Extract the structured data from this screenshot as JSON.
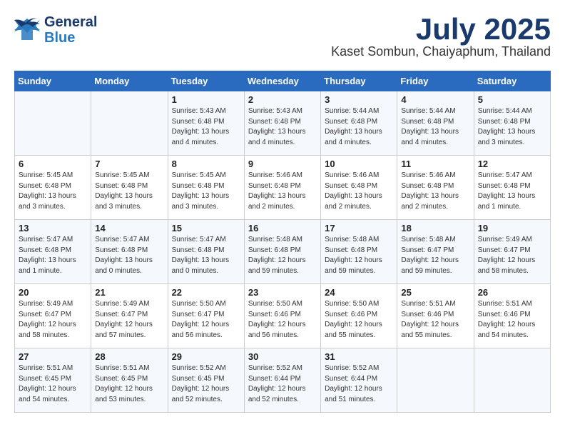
{
  "header": {
    "logo_line1": "General",
    "logo_line2": "Blue",
    "title": "July 2025",
    "subtitle": "Kaset Sombun, Chaiyaphum, Thailand"
  },
  "weekdays": [
    "Sunday",
    "Monday",
    "Tuesday",
    "Wednesday",
    "Thursday",
    "Friday",
    "Saturday"
  ],
  "weeks": [
    [
      {
        "day": "",
        "info": ""
      },
      {
        "day": "",
        "info": ""
      },
      {
        "day": "1",
        "info": "Sunrise: 5:43 AM\nSunset: 6:48 PM\nDaylight: 13 hours\nand 4 minutes."
      },
      {
        "day": "2",
        "info": "Sunrise: 5:43 AM\nSunset: 6:48 PM\nDaylight: 13 hours\nand 4 minutes."
      },
      {
        "day": "3",
        "info": "Sunrise: 5:44 AM\nSunset: 6:48 PM\nDaylight: 13 hours\nand 4 minutes."
      },
      {
        "day": "4",
        "info": "Sunrise: 5:44 AM\nSunset: 6:48 PM\nDaylight: 13 hours\nand 4 minutes."
      },
      {
        "day": "5",
        "info": "Sunrise: 5:44 AM\nSunset: 6:48 PM\nDaylight: 13 hours\nand 3 minutes."
      }
    ],
    [
      {
        "day": "6",
        "info": "Sunrise: 5:45 AM\nSunset: 6:48 PM\nDaylight: 13 hours\nand 3 minutes."
      },
      {
        "day": "7",
        "info": "Sunrise: 5:45 AM\nSunset: 6:48 PM\nDaylight: 13 hours\nand 3 minutes."
      },
      {
        "day": "8",
        "info": "Sunrise: 5:45 AM\nSunset: 6:48 PM\nDaylight: 13 hours\nand 3 minutes."
      },
      {
        "day": "9",
        "info": "Sunrise: 5:46 AM\nSunset: 6:48 PM\nDaylight: 13 hours\nand 2 minutes."
      },
      {
        "day": "10",
        "info": "Sunrise: 5:46 AM\nSunset: 6:48 PM\nDaylight: 13 hours\nand 2 minutes."
      },
      {
        "day": "11",
        "info": "Sunrise: 5:46 AM\nSunset: 6:48 PM\nDaylight: 13 hours\nand 2 minutes."
      },
      {
        "day": "12",
        "info": "Sunrise: 5:47 AM\nSunset: 6:48 PM\nDaylight: 13 hours\nand 1 minute."
      }
    ],
    [
      {
        "day": "13",
        "info": "Sunrise: 5:47 AM\nSunset: 6:48 PM\nDaylight: 13 hours\nand 1 minute."
      },
      {
        "day": "14",
        "info": "Sunrise: 5:47 AM\nSunset: 6:48 PM\nDaylight: 13 hours\nand 0 minutes."
      },
      {
        "day": "15",
        "info": "Sunrise: 5:47 AM\nSunset: 6:48 PM\nDaylight: 13 hours\nand 0 minutes."
      },
      {
        "day": "16",
        "info": "Sunrise: 5:48 AM\nSunset: 6:48 PM\nDaylight: 12 hours\nand 59 minutes."
      },
      {
        "day": "17",
        "info": "Sunrise: 5:48 AM\nSunset: 6:48 PM\nDaylight: 12 hours\nand 59 minutes."
      },
      {
        "day": "18",
        "info": "Sunrise: 5:48 AM\nSunset: 6:47 PM\nDaylight: 12 hours\nand 59 minutes."
      },
      {
        "day": "19",
        "info": "Sunrise: 5:49 AM\nSunset: 6:47 PM\nDaylight: 12 hours\nand 58 minutes."
      }
    ],
    [
      {
        "day": "20",
        "info": "Sunrise: 5:49 AM\nSunset: 6:47 PM\nDaylight: 12 hours\nand 58 minutes."
      },
      {
        "day": "21",
        "info": "Sunrise: 5:49 AM\nSunset: 6:47 PM\nDaylight: 12 hours\nand 57 minutes."
      },
      {
        "day": "22",
        "info": "Sunrise: 5:50 AM\nSunset: 6:47 PM\nDaylight: 12 hours\nand 56 minutes."
      },
      {
        "day": "23",
        "info": "Sunrise: 5:50 AM\nSunset: 6:46 PM\nDaylight: 12 hours\nand 56 minutes."
      },
      {
        "day": "24",
        "info": "Sunrise: 5:50 AM\nSunset: 6:46 PM\nDaylight: 12 hours\nand 55 minutes."
      },
      {
        "day": "25",
        "info": "Sunrise: 5:51 AM\nSunset: 6:46 PM\nDaylight: 12 hours\nand 55 minutes."
      },
      {
        "day": "26",
        "info": "Sunrise: 5:51 AM\nSunset: 6:46 PM\nDaylight: 12 hours\nand 54 minutes."
      }
    ],
    [
      {
        "day": "27",
        "info": "Sunrise: 5:51 AM\nSunset: 6:45 PM\nDaylight: 12 hours\nand 54 minutes."
      },
      {
        "day": "28",
        "info": "Sunrise: 5:51 AM\nSunset: 6:45 PM\nDaylight: 12 hours\nand 53 minutes."
      },
      {
        "day": "29",
        "info": "Sunrise: 5:52 AM\nSunset: 6:45 PM\nDaylight: 12 hours\nand 52 minutes."
      },
      {
        "day": "30",
        "info": "Sunrise: 5:52 AM\nSunset: 6:44 PM\nDaylight: 12 hours\nand 52 minutes."
      },
      {
        "day": "31",
        "info": "Sunrise: 5:52 AM\nSunset: 6:44 PM\nDaylight: 12 hours\nand 51 minutes."
      },
      {
        "day": "",
        "info": ""
      },
      {
        "day": "",
        "info": ""
      }
    ]
  ]
}
